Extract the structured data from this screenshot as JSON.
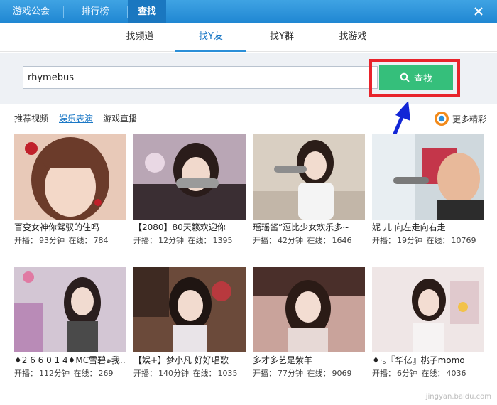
{
  "topbar": {
    "tabs": [
      {
        "label": "游戏公会"
      },
      {
        "label": "排行榜"
      },
      {
        "label": "查找"
      }
    ]
  },
  "subnav": {
    "tabs": [
      {
        "label": "找频道"
      },
      {
        "label": "找Y友"
      },
      {
        "label": "找Y群"
      },
      {
        "label": "找游戏"
      }
    ]
  },
  "search": {
    "value": "rhymebus",
    "button_label": "查找"
  },
  "categories": {
    "items": [
      {
        "label": "推荐视频"
      },
      {
        "label": "娱乐表演"
      },
      {
        "label": "游戏直播"
      }
    ],
    "more_label": "更多精彩"
  },
  "stat_labels": {
    "live": "开播：",
    "online": "在线："
  },
  "cards": [
    {
      "title": "百变女神你驾驭的住吗",
      "duration": "93分钟",
      "online": "784",
      "bg": "#e8c9b8"
    },
    {
      "title": "【2080】80天籁欢迎你",
      "duration": "12分钟",
      "online": "1395",
      "bg": "#b9a6b5"
    },
    {
      "title": "瑶瑶酱”逗比少女欢乐多~",
      "duration": "42分钟",
      "online": "1646",
      "bg": "#d9cfc2"
    },
    {
      "title": "妮  儿 向左走向右走",
      "duration": "19分钟",
      "online": "10769",
      "bg": "#cfd8dd"
    },
    {
      "title": "♦2 6 6 0 1 4♦MC雪碧๑我…",
      "duration": "112分钟",
      "online": "269",
      "bg": "#d3c6d4"
    },
    {
      "title": "【娱+】梦小凡 好好唱歌",
      "duration": "140分钟",
      "online": "1035",
      "bg": "#6b4a3a"
    },
    {
      "title": "多才多艺是紫羊",
      "duration": "77分钟",
      "online": "9069",
      "bg": "#c9a39b"
    },
    {
      "title": "♦·。『华亿』桃子momo",
      "duration": "6分钟",
      "online": "4036",
      "bg": "#efe6e6"
    }
  ],
  "watermark": "jingyan.baidu.com"
}
